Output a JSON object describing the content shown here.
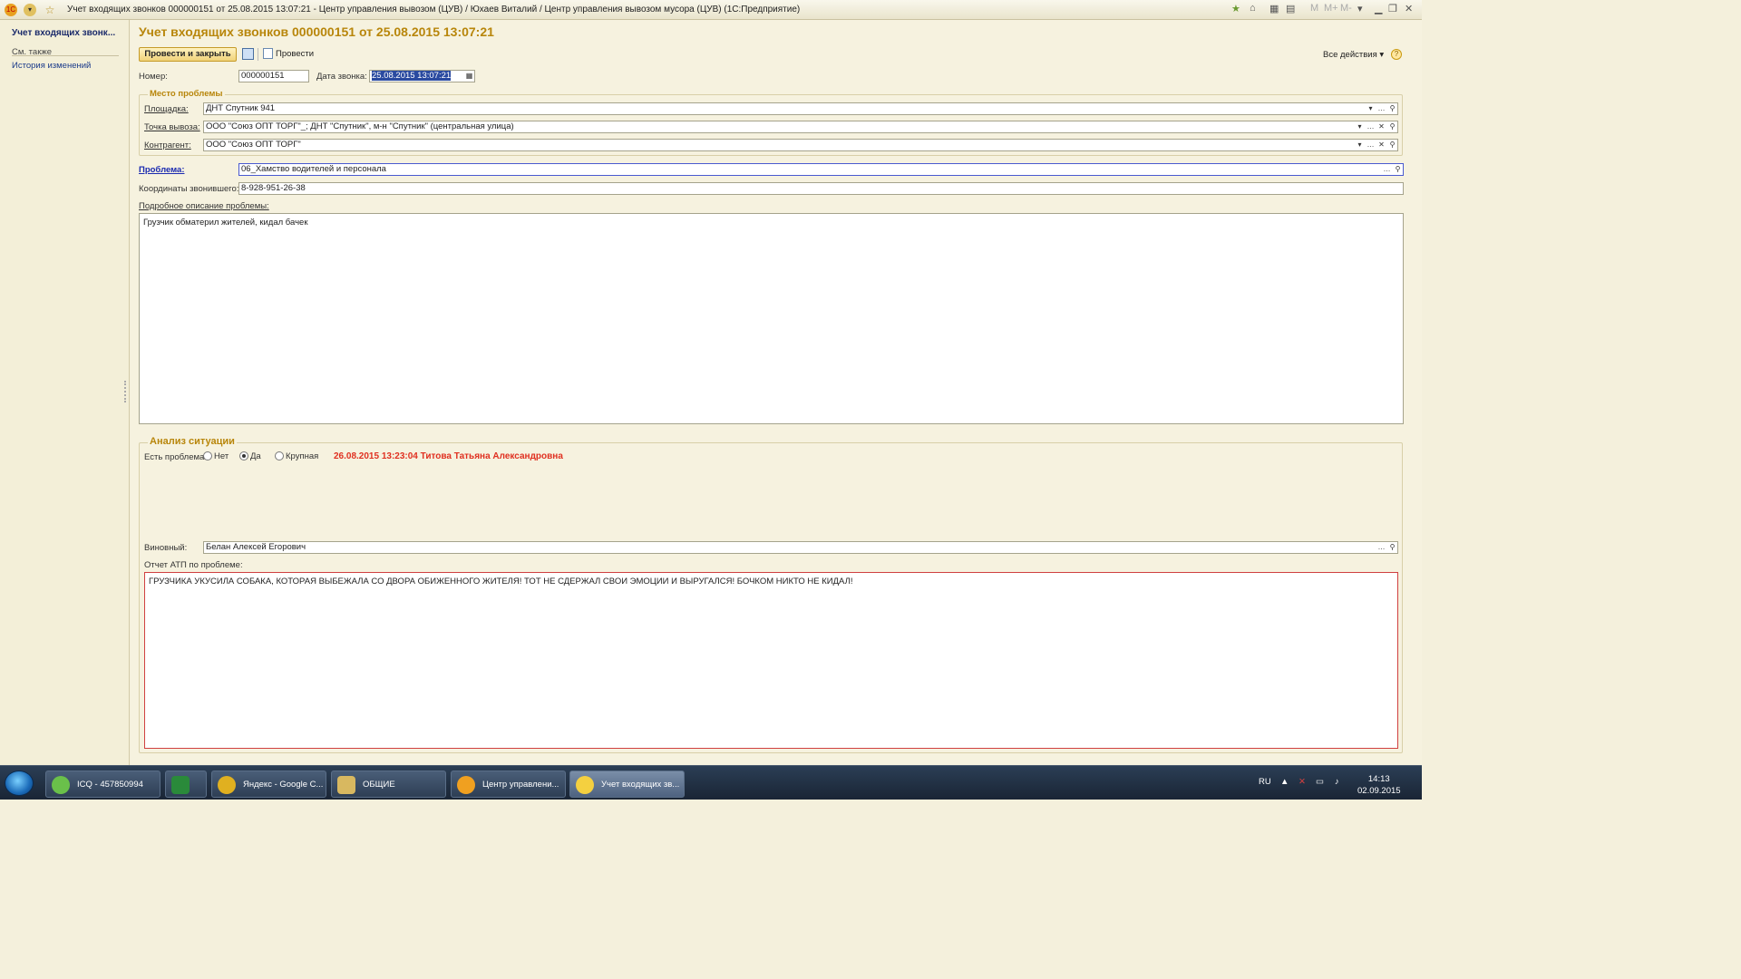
{
  "window": {
    "title": "Учет входящих звонков 000000151 от 25.08.2015 13:07:21 - Центр управления вывозом (ЦУВ) / Юхаев Виталий / Центр управления вывозом мусора (ЦУВ)  (1С:Предприятие)",
    "app_icon_text": "1С",
    "title_buttons": [
      "M",
      "M+",
      "M-"
    ]
  },
  "sidebar": {
    "current": "Учет входящих звонк...",
    "see_also": "См. также",
    "history": "История изменений"
  },
  "form": {
    "title": "Учет входящих звонков 000000151 от 25.08.2015 13:07:21",
    "toolbar": {
      "post_close": "Провести и закрыть",
      "post": "Провести",
      "all_actions": "Все действия ▾",
      "help": "?"
    },
    "number_label": "Номер:",
    "number": "000000151",
    "date_label": "Дата звонка:",
    "date": "25.08.2015 13:07:21",
    "place_group": "Место проблемы",
    "site_label": "Площадка:",
    "site": "ДНТ Спутник 941",
    "point_label": "Точка вывоза:",
    "point": "ООО \"Союз ОПТ ТОРГ\"_; ДНТ \"Спутник\", м-н \"Спутник\" (центральная улица)",
    "contractor_label": "Контрагент:",
    "contractor": "ООО \"Союз ОПТ ТОРГ\"",
    "problem_label": "Проблема:",
    "problem": "06_Хамство водителей и персонала",
    "coords_label": "Координаты звонившего:",
    "coords": "8-928-951-26-38",
    "desc_label": "Подробное описание проблемы:",
    "desc": "Грузчик обматерил жителей, кидал бачек",
    "analysis_group": "Анализ ситуации",
    "has_problem_label": "Есть проблема:",
    "radio_options": [
      "Нет",
      "Да",
      "Крупная"
    ],
    "radio_selected": "Да",
    "analysis_note": "26.08.2015 13:23:04 Титова Татьяна Александровна",
    "guilty_label": "Виновный:",
    "guilty": "Белан Алексей Егорович",
    "report_label": "Отчет АТП по проблеме:",
    "report": "ГРУЗЧИКА УКУСИЛА СОБАКА, КОТОРАЯ ВЫБЕЖАЛА СО ДВОРА ОБИЖЕННОГО ЖИТЕЛЯ! ТОТ НЕ СДЕРЖАЛ СВОИ ЭМОЦИИ И ВЫРУГАЛСЯ! БОЧКОМ НИКТО НЕ КИДАЛ!"
  },
  "taskbar": {
    "items": [
      {
        "label": "ICQ - 457850994",
        "color": "#6ac04a"
      },
      {
        "label": "",
        "color": "#2a8a3a"
      },
      {
        "label": "Яндекс - Google C...",
        "color": "#e0b020"
      },
      {
        "label": "ОБЩИЕ",
        "color": "#d8b860"
      },
      {
        "label": "Центр управлени...",
        "color": "#f0a020"
      },
      {
        "label": "Учет входящих зв...",
        "color": "#f4d040"
      }
    ],
    "lang": "RU",
    "time": "14:13",
    "date": "02.09.2015"
  }
}
